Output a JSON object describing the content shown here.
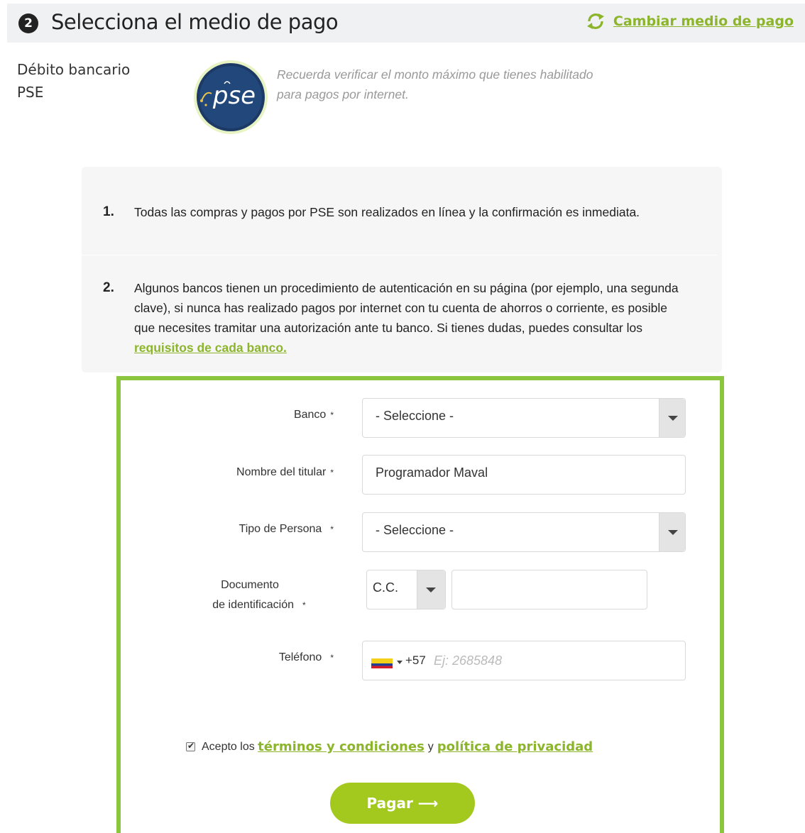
{
  "header": {
    "step_number": "2",
    "title": "Selecciona el medio de pago",
    "change_link": "Cambiar medio de pago"
  },
  "method": {
    "name_line1": "Débito bancario",
    "name_line2": "PSE",
    "logo_text": "pse",
    "note": "Recuerda verificar el monto máximo que tienes habilitado para pagos por internet."
  },
  "info": {
    "items": [
      {
        "number": "1.",
        "text": "Todas las compras y pagos por PSE son realizados en línea y la confirmación es inmediata."
      },
      {
        "number": "2.",
        "text": "Algunos bancos tienen un procedimiento de autenticación en su página (por ejemplo, una segunda clave), si nunca has realizado pagos por internet con tu cuenta de ahorros o corriente, es posible que necesites tramitar una autorización ante tu banco. Si tienes dudas, puedes consultar los ",
        "link": "requisitos de cada banco."
      }
    ]
  },
  "form": {
    "required_mark": "*",
    "bank": {
      "label": "Banco",
      "value": "- Seleccione -"
    },
    "holder": {
      "label": "Nombre del titular",
      "value": "Programador Maval"
    },
    "person_type": {
      "label": "Tipo de Persona",
      "value": "- Seleccione -"
    },
    "document": {
      "label_line1": "Documento",
      "label_line2": "de identificación",
      "type_value": "C.C.",
      "number_value": ""
    },
    "phone": {
      "label": "Teléfono",
      "country_code": "+57",
      "placeholder": "Ej: 2685848"
    },
    "terms": {
      "prefix": "Acepto los",
      "link1": "términos y condiciones",
      "middle": "y",
      "link2": "política de privacidad",
      "checked": true
    },
    "submit": {
      "label": "Pagar ⟶"
    }
  },
  "colors": {
    "accent": "#8cb52c",
    "panel_border": "#8cc63f",
    "button": "#a3c91f"
  }
}
